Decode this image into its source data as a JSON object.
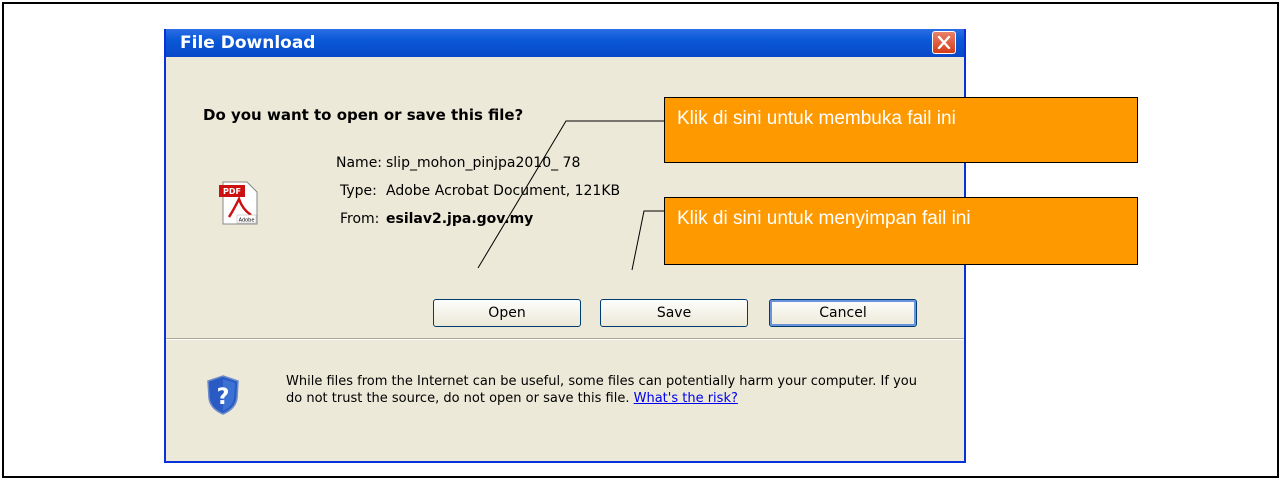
{
  "dialog": {
    "title": "File Download",
    "question": "Do you want to open or save this file?",
    "file": {
      "name_label": "Name:",
      "name_value": "slip_mohon_pinjpa2010_ 78",
      "type_label": "Type:",
      "type_value": "Adobe Acrobat Document, 121KB",
      "from_label": "From:",
      "from_value": "esilav2.jpa.gov.my",
      "icon": "pdf-icon",
      "icon_badge": "PDF",
      "icon_caption": "Adobe"
    },
    "buttons": {
      "open": "Open",
      "save": "Save",
      "cancel": "Cancel"
    },
    "warning_text": "While files from the Internet can be useful, some files can potentially harm your computer. If you do not trust the source, do not open or save this file.",
    "risk_link": "What's the risk?"
  },
  "callouts": {
    "open": "Klik di sini untuk membuka fail ini",
    "save": "Klik di sini untuk menyimpan fail ini"
  },
  "colors": {
    "titlebar": "#0a58d6",
    "dialog_bg": "#ece9d8",
    "callout_bg": "#ff9900",
    "close": "#d43c16"
  }
}
